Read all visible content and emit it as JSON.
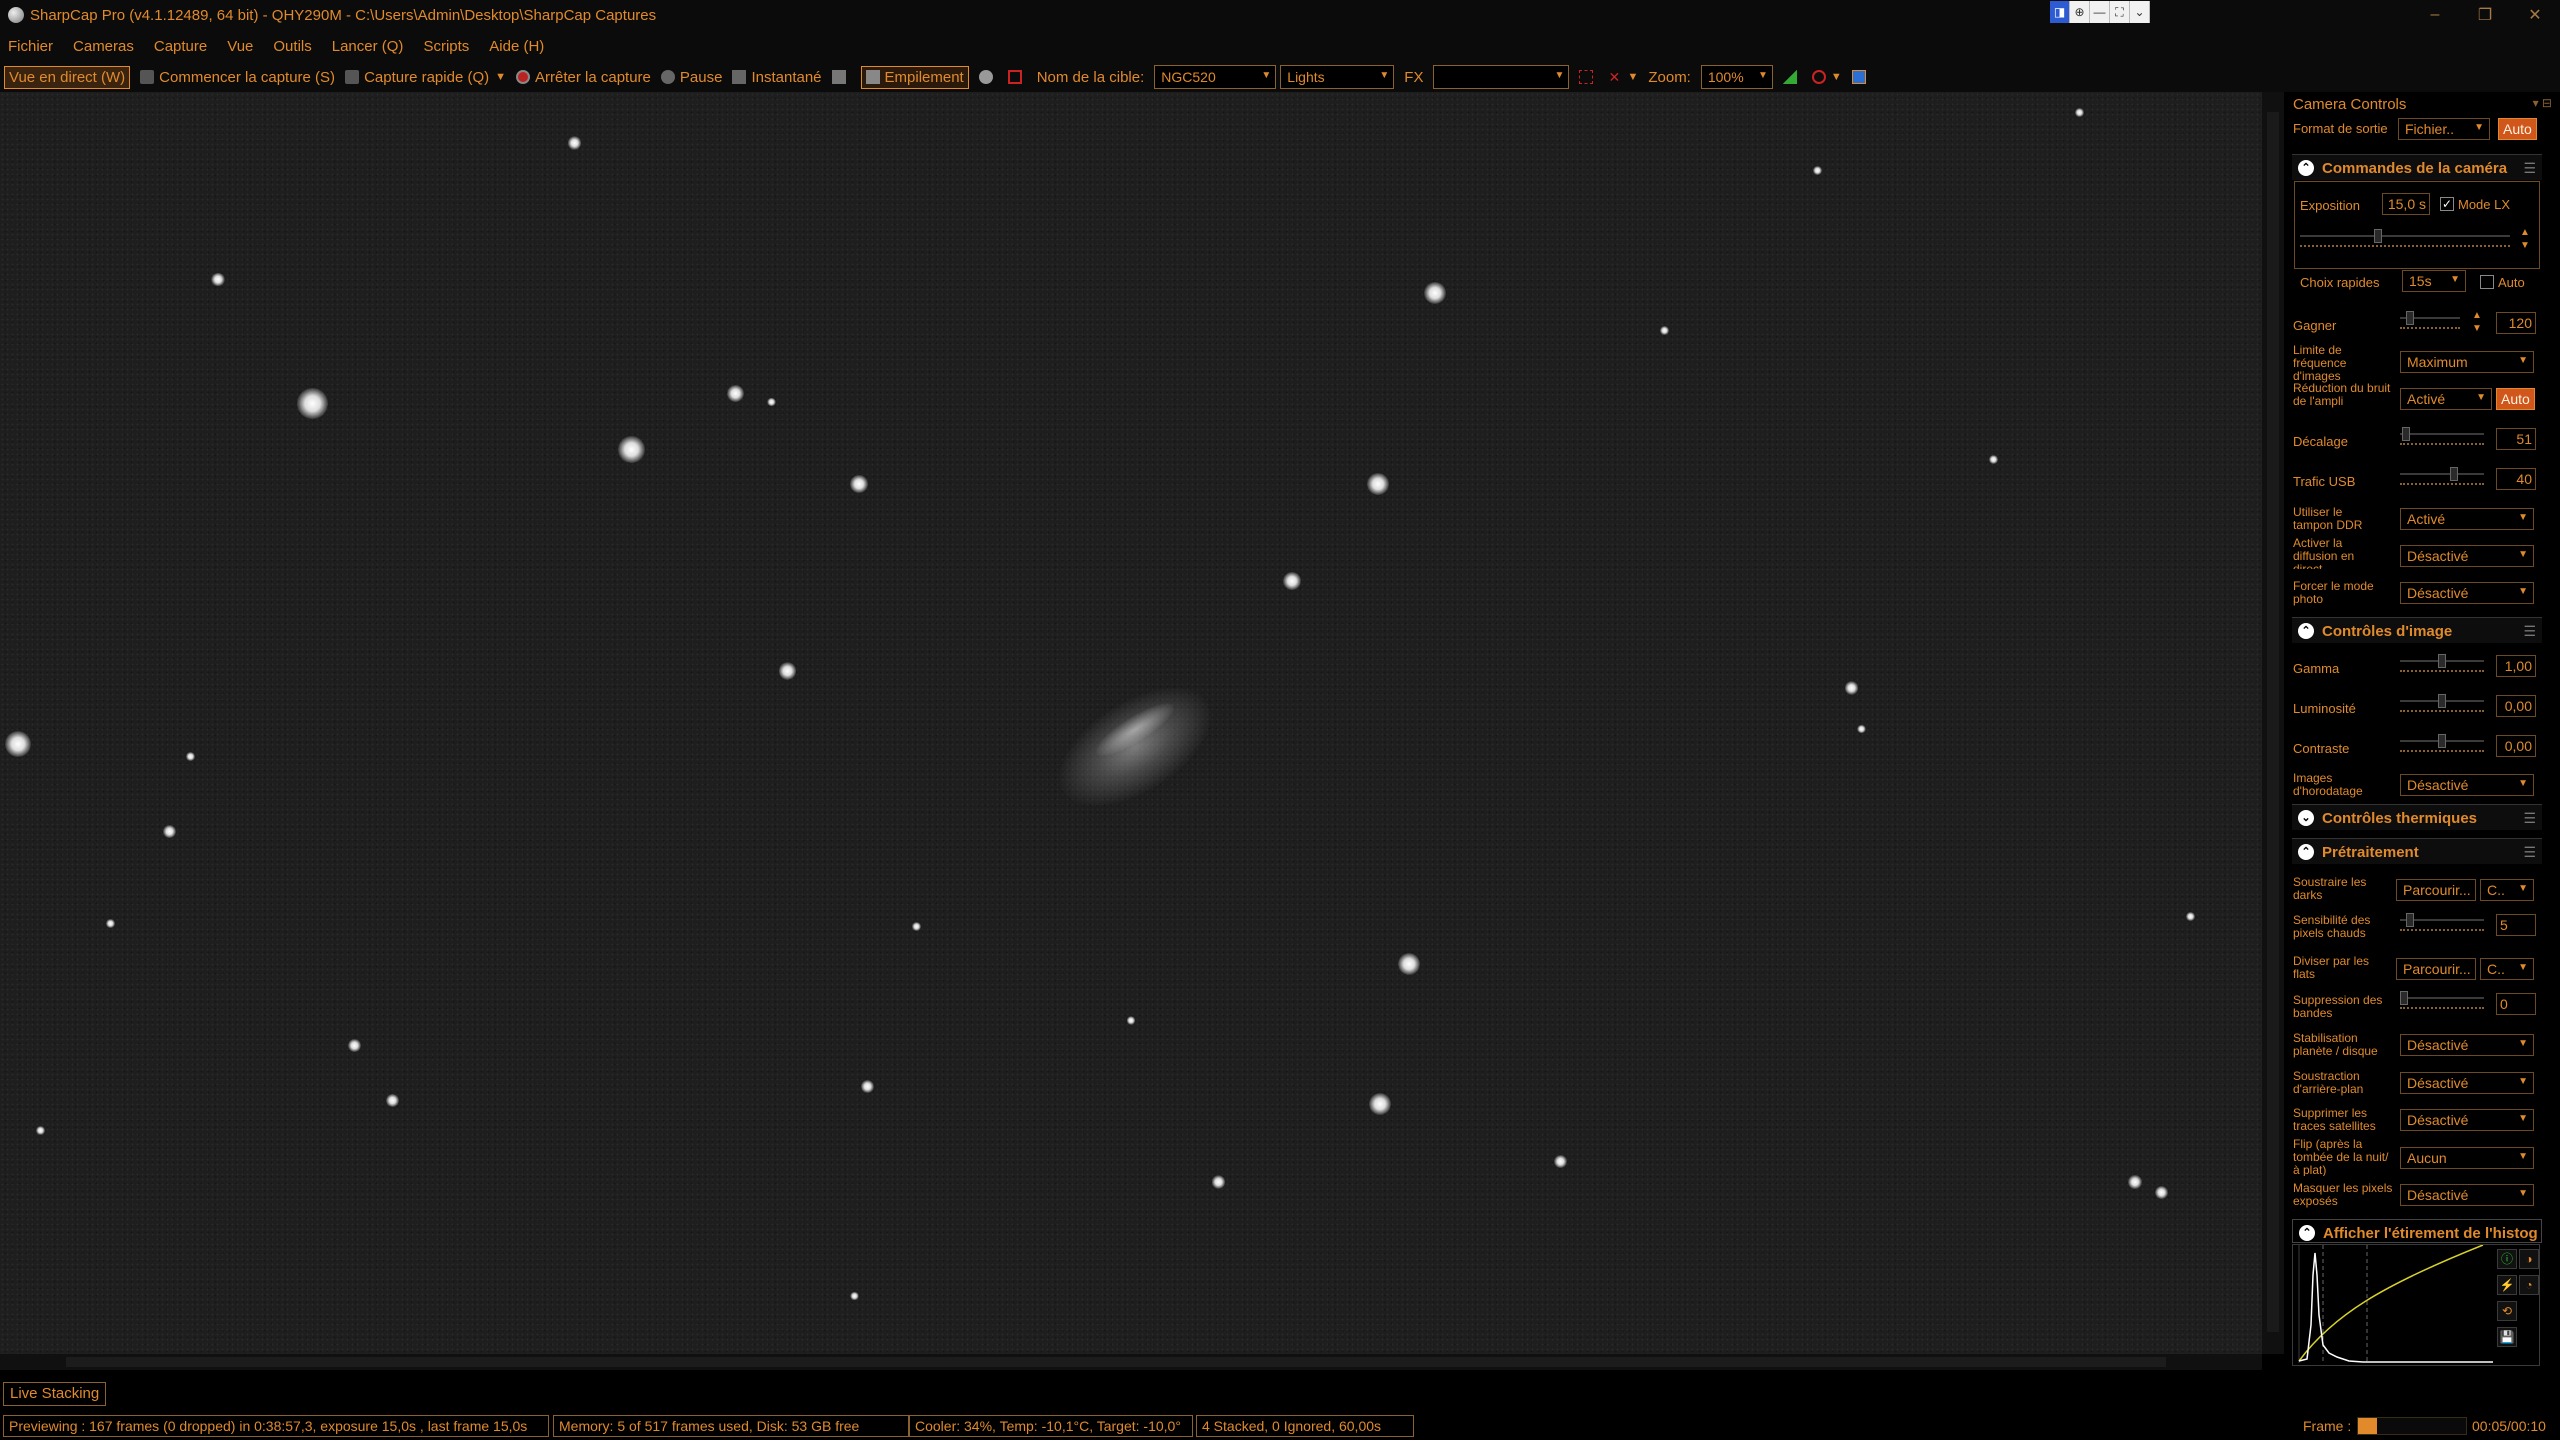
{
  "window": {
    "title": "SharpCap Pro (v4.1.12489, 64 bit) - QHY290M - C:\\Users\\Admin\\Desktop\\SharpCap Captures",
    "tray_icons": [
      "◨",
      "⊕",
      "—",
      "⛶",
      "⌄"
    ],
    "controls": [
      "–",
      "❐",
      "✕"
    ]
  },
  "menu": [
    "Fichier",
    "Cameras",
    "Capture",
    "Vue",
    "Outils",
    "Lancer (Q)",
    "Scripts",
    "Aide (H)"
  ],
  "toolbar": {
    "live_view": "Vue en direct (W)",
    "start_capture": "Commencer la capture (S)",
    "quick_capture": "Capture rapide (Q)",
    "stop_capture": "Arrêter la capture",
    "pause": "Pause",
    "snapshot": "Instantané",
    "stacking": "Empilement",
    "target_label": "Nom de la cible:",
    "target_value": "NGC520",
    "frame_type": "Lights",
    "fx_label": "FX",
    "fx_value": "",
    "zoom_label": "Zoom:",
    "zoom_value": "100%"
  },
  "panel": {
    "title": "Camera Controls",
    "title_icons": "▾ ⊟",
    "output_format_label": "Format de sortie",
    "output_format_value": "Fichier..",
    "output_format_auto": "Auto",
    "sections": {
      "camera": "Commandes de la caméra",
      "image": "Contrôles d'image",
      "thermal": "Contrôles thermiques",
      "preprocessing": "Prétraitement",
      "histogram": "Afficher l'étirement de l'histogr"
    },
    "camera": {
      "exposure_label": "Exposition",
      "exposure_value": "15,0 s",
      "lx_label": "Mode LX",
      "lx_checked": "✓",
      "quick_label": "Choix rapides",
      "quick_value": "15s",
      "quick_auto": "Auto",
      "gain_label": "Gagner",
      "gain_value": "120",
      "fps_label": "Limite de fréquence d'images",
      "fps_value": "Maximum",
      "ampnoise_label": "Réduction du bruit de l'ampli",
      "ampnoise_value": "Activé",
      "ampnoise_auto": "Auto",
      "offset_label": "Décalage",
      "offset_value": "51",
      "usb_label": "Trafic USB",
      "usb_value": "40",
      "ddr_label": "Utiliser le tampon DDR",
      "ddr_value": "Activé",
      "stream_label": "Activer la diffusion en direct",
      "stream_value": "Désactivé",
      "photo_label": "Forcer le mode photo",
      "photo_value": "Désactivé"
    },
    "image": {
      "gamma_label": "Gamma",
      "gamma_value": "1,00",
      "bright_label": "Luminosité",
      "bright_value": "0,00",
      "contrast_label": "Contraste",
      "contrast_value": "0,00",
      "timestamp_label": "Images d'horodatage",
      "timestamp_value": "Désactivé"
    },
    "pre": {
      "darks_label": "Soustraire les darks",
      "darks_browse": "Parcourir...",
      "darks_c": "C..",
      "hot_label": "Sensibilité des pixels chauds",
      "hot_value": "5",
      "flats_label": "Diviser par les flats",
      "flats_browse": "Parcourir...",
      "flats_c": "C..",
      "banding_label": "Suppression des bandes",
      "banding_value": "0",
      "stab_label": "Stabilisation planète / disque",
      "stab_value": "Désactivé",
      "bg_label": "Soustraction d'arrière-plan",
      "bg_value": "Désactivé",
      "sat_label": "Supprimer les traces satellites",
      "sat_value": "Désactivé",
      "flip_label": "Flip (après la tombée de la nuit/à plat)",
      "flip_value": "Aucun",
      "mask_label": "Masquer les pixels exposés",
      "mask_value": "Désactivé"
    },
    "hist_icons": [
      "ⓘ",
      "◑",
      "⚡",
      "◔",
      "⟲",
      "💾"
    ]
  },
  "live_stacking_tab": "Live Stacking",
  "status": {
    "previewing": "Previewing : 167 frames (0 dropped) in 0:38:57,3, exposure 15,0s , last frame 15,0s",
    "memory": "Memory: 5 of 517 frames used, Disk: 53 GB free",
    "cooler": "Cooler: 34%, Temp: -10,1°C, Target: -10,0°",
    "stacked": "4 Stacked, 0 Ignored, 60,00s",
    "frame_label": "Frame :",
    "frame_progress": 0.18,
    "frame_time": "00:05/00:10"
  },
  "colors": {
    "accent": "#e08a2c",
    "auto_button": "#d0561c",
    "background": "#000000",
    "sky": "#1e1e1e"
  }
}
